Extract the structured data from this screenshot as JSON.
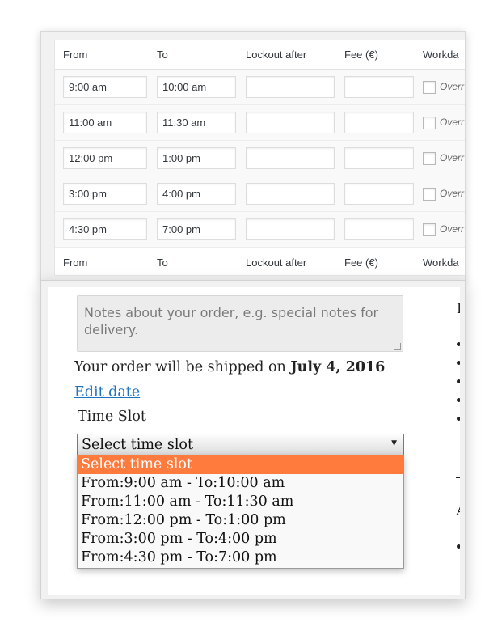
{
  "admin_table": {
    "columns": [
      "From",
      "To",
      "Lockout after",
      "Fee (€)",
      "Workda"
    ],
    "rows": [
      {
        "from": "9:00 am",
        "to": "10:00 am",
        "lockout": "",
        "fee": "",
        "override": "Overr"
      },
      {
        "from": "11:00 am",
        "to": "11:30 am",
        "lockout": "",
        "fee": "",
        "override": "Overr"
      },
      {
        "from": "12:00 pm",
        "to": "1:00 pm",
        "lockout": "",
        "fee": "",
        "override": "Overr"
      },
      {
        "from": "3:00 pm",
        "to": "4:00 pm",
        "lockout": "",
        "fee": "",
        "override": "Overr"
      },
      {
        "from": "4:30 pm",
        "to": "7:00 pm",
        "lockout": "",
        "fee": "",
        "override": "Overr"
      }
    ]
  },
  "checkout": {
    "notes_placeholder": "Notes about your order, e.g. special notes for delivery.",
    "ship_prefix": "Your order will be shipped on",
    "ship_date": "July 4, 2016",
    "edit_date_link": "Edit date",
    "time_slot_label": "Time Slot",
    "select_value": "Select time slot",
    "options": [
      "Select time slot",
      "From:9:00 am - To:10:00 am",
      "From:11:00 am - To:11:30 am",
      "From:12:00 pm - To:1:00 pm",
      "From:3:00 pm - To:4:00 pm",
      "From:4:30 pm - To:7:00 pm"
    ],
    "side_heading_fragment": "F",
    "side_heading_fragment_2": "A"
  },
  "colors": {
    "accent_orange": "#ff7b3d",
    "link_blue": "#1e73be",
    "select_border": "#6b8b3a"
  }
}
